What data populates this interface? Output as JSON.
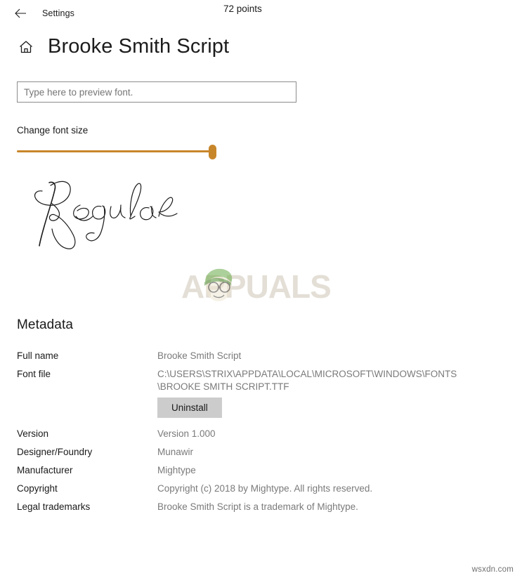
{
  "titlebar": {
    "back_icon": "back-arrow-icon",
    "label": "Settings"
  },
  "header": {
    "home_icon": "home-icon",
    "title": "Brooke Smith Script"
  },
  "preview": {
    "placeholder": "Type here to preview font.",
    "value": ""
  },
  "font_size": {
    "label": "Change font size",
    "value_text": "72 points",
    "points": 72,
    "slider_fill_color": "#c8862b",
    "thumb_color": "#c8862b",
    "percent": 96
  },
  "sample": {
    "text": "Regular",
    "color": "#1a1a1a"
  },
  "watermark": {
    "brand": "APPUALS",
    "mascot_icon": "mascot-face-icon",
    "brand_color": "#c9bfae",
    "hat_color": "#6aab48"
  },
  "metadata": {
    "heading": "Metadata",
    "rows": [
      {
        "label": "Full name",
        "value": "Brooke Smith Script"
      },
      {
        "label": "Font file",
        "value": "C:\\USERS\\STRIX\\APPDATA\\LOCAL\\MICROSOFT\\WINDOWS\\FONTS\n\\BROOKE SMITH SCRIPT.TTF"
      },
      {
        "label": "Version",
        "value": "Version 1.000"
      },
      {
        "label": "Designer/Foundry",
        "value": "Munawir"
      },
      {
        "label": "Manufacturer",
        "value": "Mightype"
      },
      {
        "label": "Copyright",
        "value": "Copyright (c) 2018 by Mightype. All rights reserved."
      },
      {
        "label": "Legal trademarks",
        "value": "Brooke Smith Script is a trademark of Mightype."
      }
    ],
    "uninstall_label": "Uninstall"
  },
  "footer": {
    "source": "wsxdn.com"
  }
}
